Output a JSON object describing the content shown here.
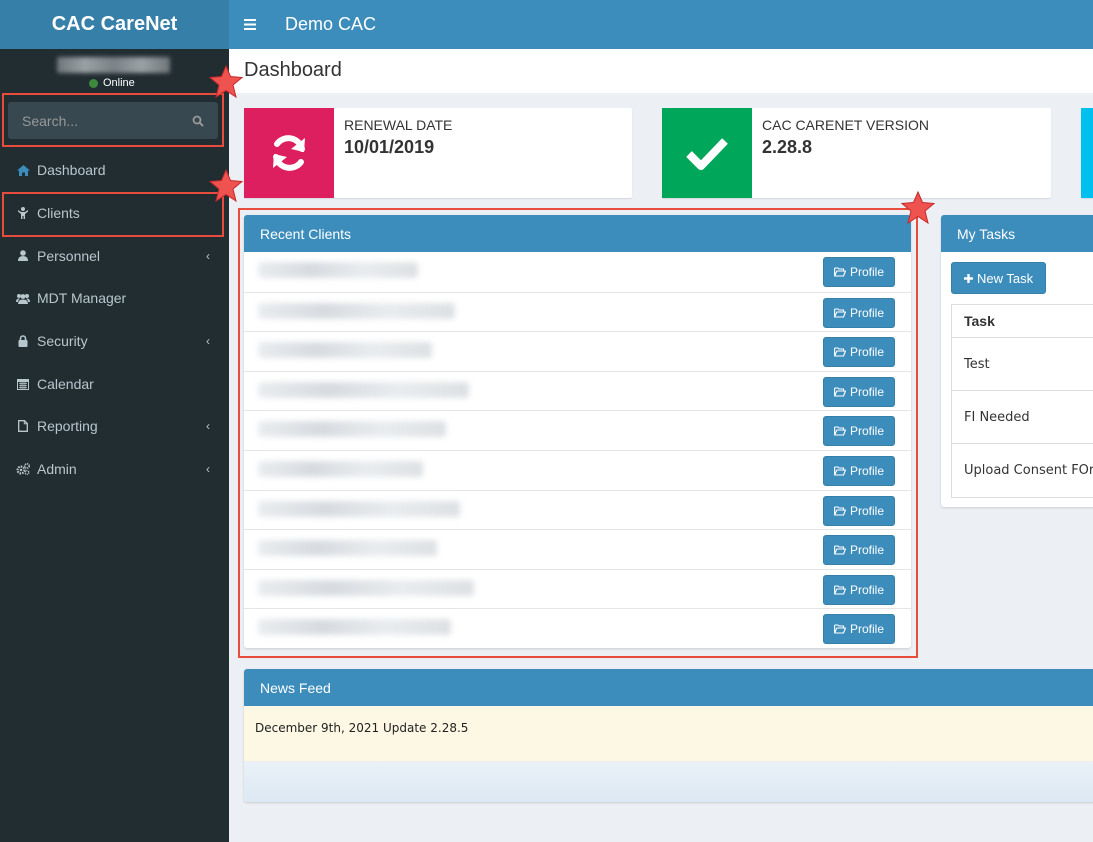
{
  "app": {
    "logo": "CAC CareNet",
    "org_name": "Demo CAC"
  },
  "user": {
    "status": "Online"
  },
  "search": {
    "placeholder": "Search..."
  },
  "sidebar": {
    "items": [
      {
        "label": "Dashboard",
        "icon": "home-icon",
        "active": true
      },
      {
        "label": "Clients",
        "icon": "child-icon"
      },
      {
        "label": "Personnel",
        "icon": "user-icon",
        "expandable": true
      },
      {
        "label": "MDT Manager",
        "icon": "users-icon"
      },
      {
        "label": "Security",
        "icon": "lock-icon",
        "expandable": true
      },
      {
        "label": "Calendar",
        "icon": "calendar-icon"
      },
      {
        "label": "Reporting",
        "icon": "file-icon",
        "expandable": true
      },
      {
        "label": "Admin",
        "icon": "cogs-icon",
        "expandable": true
      }
    ]
  },
  "page": {
    "title": "Dashboard"
  },
  "info_boxes": [
    {
      "label": "RENEWAL DATE",
      "value": "10/01/2019",
      "color": "#dd1e5f",
      "icon": "refresh-icon"
    },
    {
      "label": "CAC CARENET VERSION",
      "value": "2.28.8",
      "color": "#00a65a",
      "icon": "check-icon"
    },
    {
      "label": "",
      "value": "",
      "color": "#00c0ef",
      "icon": ""
    }
  ],
  "recent_clients": {
    "title": "Recent Clients",
    "button_label": "Profile",
    "row_count": 10
  },
  "tasks": {
    "title": "My Tasks",
    "new_task_label": "New Task",
    "column_header": "Task",
    "items": [
      "Test",
      "FI Needed",
      "Upload Consent FOrm"
    ]
  },
  "news_feed": {
    "title": "News Feed",
    "entry": "December 9th, 2021 Update 2.28.5"
  },
  "colors": {
    "sidebar_bg": "#222d32",
    "header_bg": "#3c8dbc",
    "logo_bg": "#367fa9",
    "highlight": "#e74c3c",
    "star": "#ef5350"
  }
}
